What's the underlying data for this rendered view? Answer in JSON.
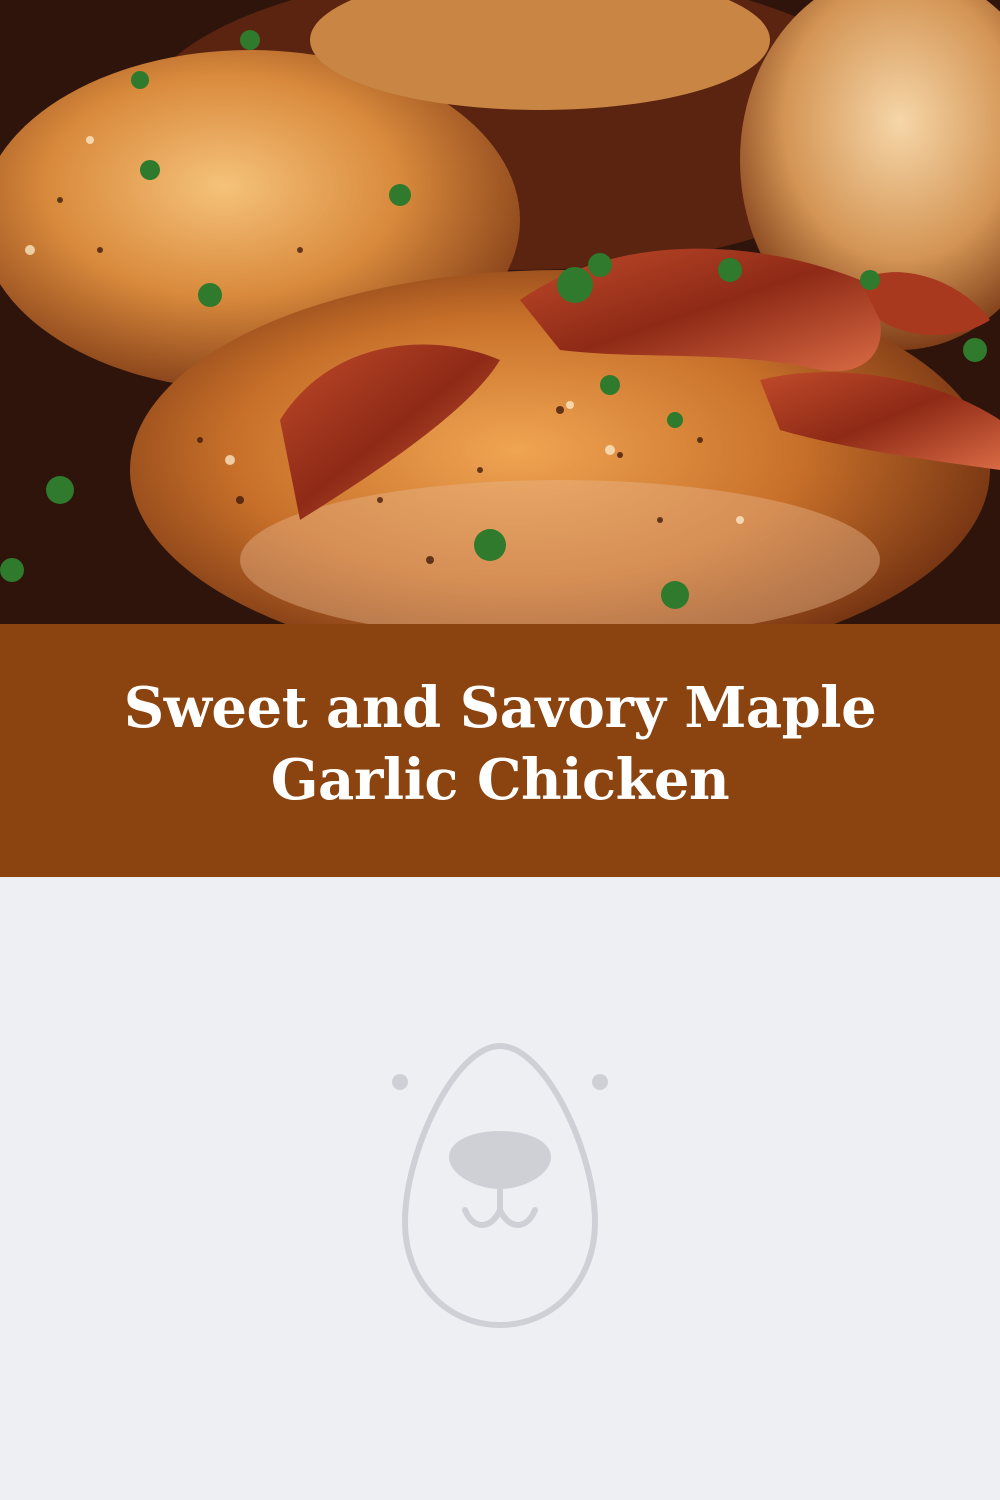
{
  "pin": {
    "title": "Sweet and Savory Maple Garlic Chicken",
    "banner_color": "#8b4410",
    "title_color": "#ffffff",
    "background_color": "#eeeff3"
  },
  "photo": {
    "subject": "glazed chicken thighs with bacon and parsley"
  },
  "placeholder": {
    "icon": "bear-face-icon",
    "icon_color": "#cfd0d6"
  }
}
